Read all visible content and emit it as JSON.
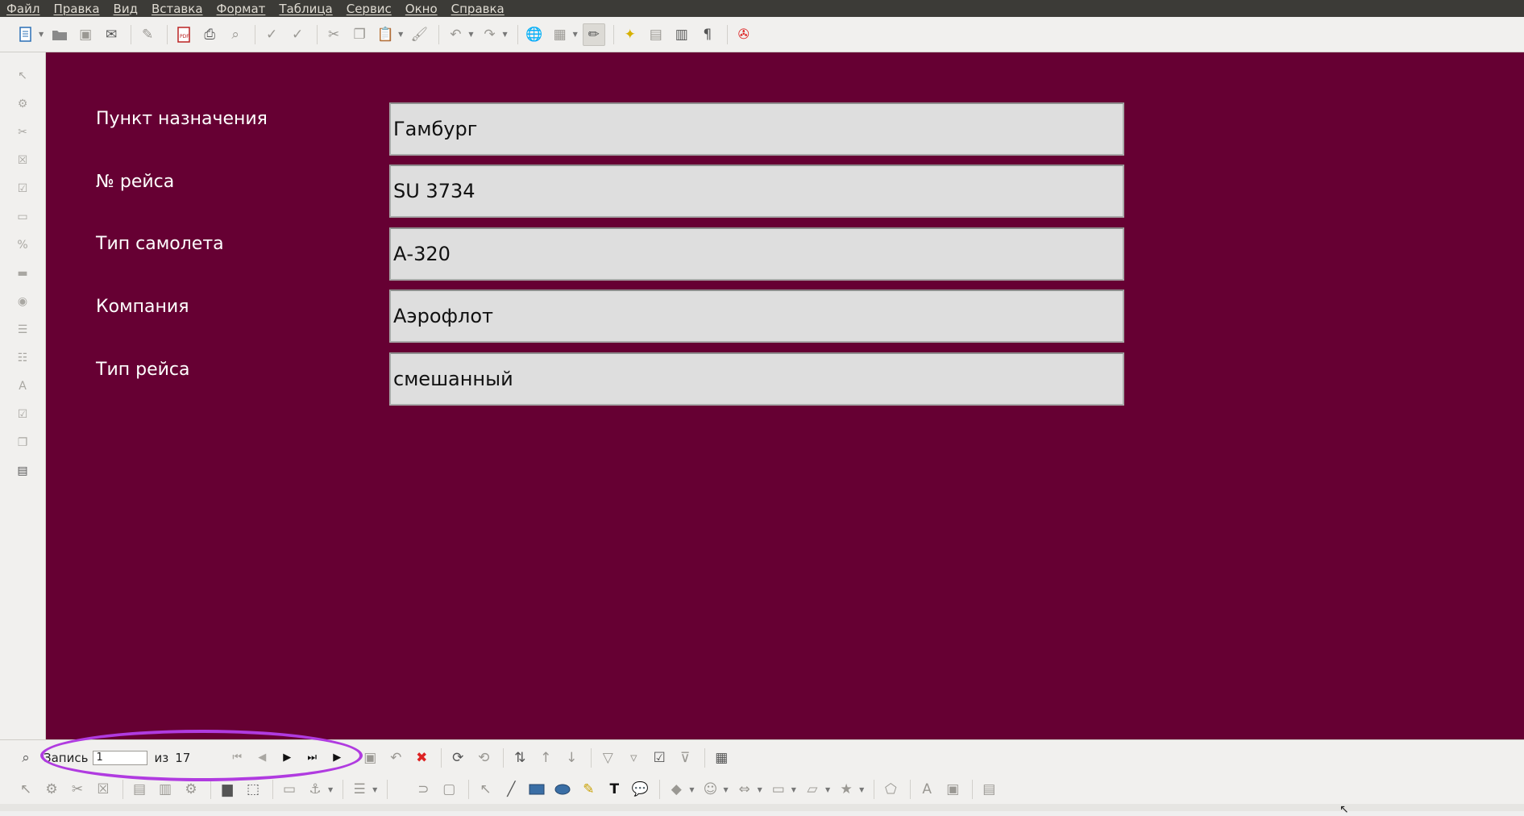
{
  "menu": [
    "Файл",
    "Правка",
    "Вид",
    "Вставка",
    "Формат",
    "Таблица",
    "Сервис",
    "Окно",
    "Справка"
  ],
  "toolbar_icons": [
    "new-icon",
    "open-icon",
    "save-icon",
    "email-icon",
    "edit-icon",
    "pdf-icon",
    "print-icon",
    "preview-icon",
    "spellcheck-icon",
    "autospell-icon",
    "cut-icon",
    "copy-icon",
    "paste-icon",
    "clone-icon",
    "undo-icon",
    "redo-icon",
    "hyperlink-icon",
    "table-icon",
    "draw-functions-icon",
    "navigator-icon",
    "gallery-icon",
    "datasources-icon",
    "formatting-marks-icon",
    "help-icon"
  ],
  "left_toolbar_icons": [
    "select-icon",
    "design-mode-icon",
    "control-wizards-icon",
    "form-design-icon",
    "checkbox-icon",
    "textbox-icon",
    "formatted-field-icon",
    "push-button-icon",
    "option-button-icon",
    "listbox-icon",
    "combobox-icon",
    "label-icon",
    "more-controls-icon",
    "form-navigator-icon",
    "form-design-mode-icon"
  ],
  "form": {
    "fields": [
      {
        "label": "Пункт назначения",
        "value": "Гамбург"
      },
      {
        "label": "№ рейса",
        "value": "SU 3734"
      },
      {
        "label": "Тип самолета",
        "value": "А-320"
      },
      {
        "label": "Компания",
        "value": "Аэрофлот"
      },
      {
        "label": "Тип рейса",
        "value": "смешанный"
      }
    ],
    "background": "#660033"
  },
  "navigation": {
    "record_label": "Запись",
    "record_value": "1",
    "of_label": "из",
    "total": "17"
  },
  "draw_toolbar_icons": [
    "select-icon",
    "line-icon",
    "rectangle-icon",
    "ellipse-icon",
    "freeform-icon",
    "text-icon",
    "callout-icon",
    "basic-shapes-icon",
    "symbol-shapes-icon",
    "block-arrows-icon",
    "flowchart-icon",
    "callouts-icon",
    "stars-icon",
    "points-icon",
    "fontwork-icon",
    "extrusion-icon"
  ],
  "highlight_color": "#b03be0"
}
